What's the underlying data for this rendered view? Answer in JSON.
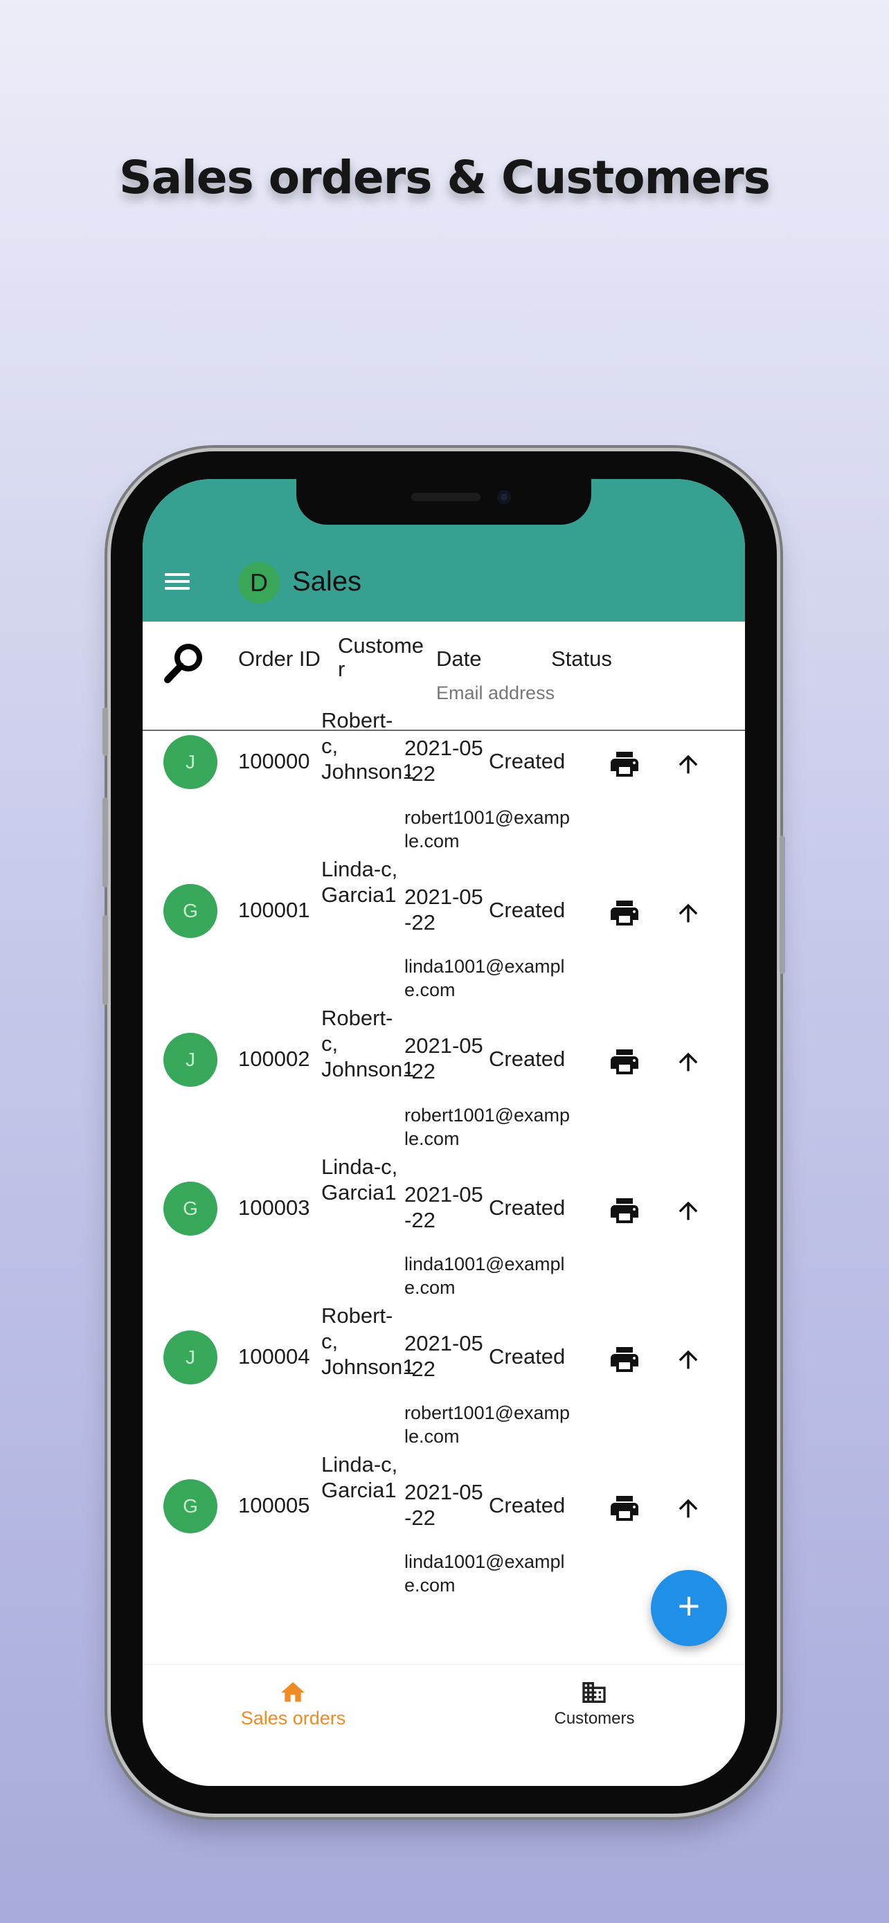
{
  "promo": {
    "title": "Sales orders & Customers"
  },
  "appbar": {
    "avatar_letter": "D",
    "title": "Sales",
    "menu_icon": "menu-icon"
  },
  "header": {
    "search_icon": "search-icon",
    "order_id": "Order ID",
    "customer": "Custome r",
    "date": "Date",
    "status": "Status",
    "email": "Email address"
  },
  "orders": [
    {
      "avatar": "J",
      "order_id": "100000",
      "customer": "Robert-c, Johnson1",
      "date": "2021-05-22",
      "status": "Created",
      "email": "robert1001@example.com"
    },
    {
      "avatar": "G",
      "order_id": "100001",
      "customer": "Linda-c, Garcia1",
      "date": "2021-05-22",
      "status": "Created",
      "email": "linda1001@example.com"
    },
    {
      "avatar": "J",
      "order_id": "100002",
      "customer": "Robert-c, Johnson1",
      "date": "2021-05-22",
      "status": "Created",
      "email": "robert1001@example.com"
    },
    {
      "avatar": "G",
      "order_id": "100003",
      "customer": "Linda-c, Garcia1",
      "date": "2021-05-22",
      "status": "Created",
      "email": "linda1001@example.com"
    },
    {
      "avatar": "J",
      "order_id": "100004",
      "customer": "Robert-c, Johnson1",
      "date": "2021-05-22",
      "status": "Created",
      "email": "robert1001@example.com"
    },
    {
      "avatar": "G",
      "order_id": "100005",
      "customer": "Linda-c, Garcia1",
      "date": "2021-05-22",
      "status": "Created",
      "email": "linda1001@example.com"
    }
  ],
  "row_icons": {
    "print": "print-icon",
    "upload": "arrow-up-icon"
  },
  "fab": {
    "label": "+"
  },
  "bottom_nav": {
    "items": [
      {
        "label": "Sales orders",
        "icon": "home-icon",
        "active": true
      },
      {
        "label": "Customers",
        "icon": "business-icon",
        "active": false
      }
    ]
  },
  "colors": {
    "appbar": "#36a191",
    "avatar": "#37a75a",
    "fab": "#1f8fe8",
    "nav_active": "#f08a24"
  }
}
